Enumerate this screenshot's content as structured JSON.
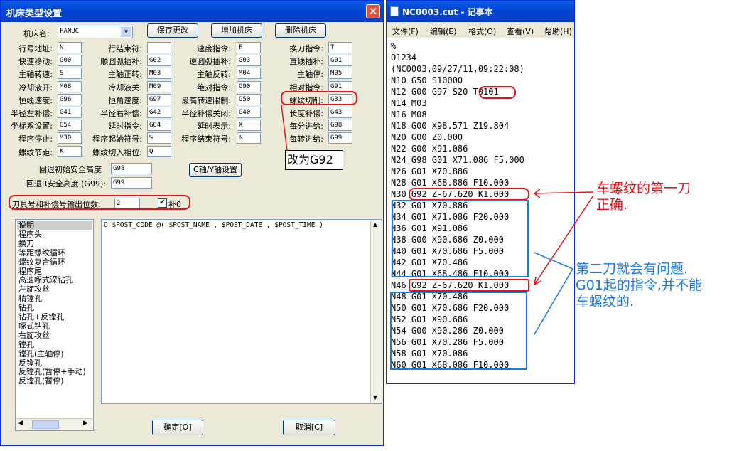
{
  "dialog": {
    "title": "机床类型设置",
    "close_glyph": "✕",
    "machine_label": "机床名:",
    "machine_value": "FANUC",
    "buttons": {
      "save": "保存更改",
      "add": "增加机床",
      "delete": "删除机床",
      "caxis": "C轴/Y轴设置",
      "ok": "确定[O]",
      "cancel": "取消[C]"
    },
    "params": [
      [
        {
          "label": "行号地址:",
          "value": "N"
        },
        {
          "label": "行结束符:",
          "value": ""
        },
        {
          "label": "速度指令:",
          "value": "F"
        },
        {
          "label": "换刀指令:",
          "value": "T"
        }
      ],
      [
        {
          "label": "快速移动:",
          "value": "G00"
        },
        {
          "label": "顺圆弧插补:",
          "value": "G02"
        },
        {
          "label": "逆圆弧插补:",
          "value": "G03"
        },
        {
          "label": "直线插补:",
          "value": "G01"
        }
      ],
      [
        {
          "label": "主轴转速:",
          "value": "S"
        },
        {
          "label": "主轴正转:",
          "value": "M03"
        },
        {
          "label": "主轴反转:",
          "value": "M04"
        },
        {
          "label": "主轴停:",
          "value": "M05"
        }
      ],
      [
        {
          "label": "冷却液开:",
          "value": "M08"
        },
        {
          "label": "冷却液关:",
          "value": "M09"
        },
        {
          "label": "绝对指令:",
          "value": "G90"
        },
        {
          "label": "相对指令:",
          "value": "G91"
        }
      ],
      [
        {
          "label": "恒线速度:",
          "value": "G96"
        },
        {
          "label": "恒角速度:",
          "value": "G97"
        },
        {
          "label": "最高转速限制:",
          "value": "G50"
        },
        {
          "label": "螺纹切削:",
          "value": "G33"
        }
      ],
      [
        {
          "label": "半径左补偿:",
          "value": "G41"
        },
        {
          "label": "半径右补偿:",
          "value": "G42"
        },
        {
          "label": "半径补偿关闭:",
          "value": "G40"
        },
        {
          "label": "长度补偿:",
          "value": "G43"
        }
      ],
      [
        {
          "label": "坐标系设置:",
          "value": "G54"
        },
        {
          "label": "延时指令:",
          "value": "G04"
        },
        {
          "label": "延时表示:",
          "value": "X"
        },
        {
          "label": "每分进给:",
          "value": "G98"
        }
      ],
      [
        {
          "label": "程序停止:",
          "value": "M30"
        },
        {
          "label": "程序起始符号:",
          "value": "%"
        },
        {
          "label": "程序结束符号:",
          "value": "%"
        },
        {
          "label": "每转进给:",
          "value": "G99"
        }
      ],
      [
        {
          "label": "螺纹节距:",
          "value": "K"
        },
        {
          "label": "螺纹切入相位:",
          "value": "Q"
        }
      ]
    ],
    "retract_init_label": "回退初始安全高度",
    "retract_init_value": "G98",
    "retract_r_label": "回退R安全高度 (G99):",
    "retract_r_value": "G99",
    "tool_digits_label": "刀具号和补偿号输出位数:",
    "tool_digits_value": "2",
    "comp_checkbox_label": "补0",
    "comp_checked": true,
    "list_items": [
      "说明",
      "程序头",
      "换刀",
      "等距螺纹循环",
      "螺纹复合循环",
      "程序尾",
      "高速啄式深钻孔",
      "左旋攻丝",
      "精镗孔",
      "钻孔",
      "钻孔+反镗孔",
      "啄式钻孔",
      "右旋攻丝",
      "镗孔",
      "镗孔(主轴停)",
      "反镗孔",
      "反镗孔(暂停+手动)",
      "反镗孔(暂停)"
    ],
    "code_text": "O $POST_CODE @( $POST_NAME , $POST_DATE , $POST_TIME )"
  },
  "notepad": {
    "title": "NC0003.cut - 记事本",
    "menu": [
      "文件(F)",
      "编辑(E)",
      "格式(O)",
      "查看(V)",
      "帮助(H)"
    ],
    "lines": [
      "%",
      "O1234",
      "(NC0003,09/27/11,09:22:08)",
      "N10 G50 S10000",
      "N12 G00 G97 S20 T0101",
      "N14 M03",
      "N16 M08",
      "N18 G00 X98.571 Z19.804",
      "N20 G00 Z0.000",
      "N22 G00 X91.086",
      "N24 G98 G01 X71.086 F5.000",
      "N26 G01 X70.886",
      "N28 G01 X68.886 F10.000",
      "N30 G92 Z-67.620 K1.000",
      "N32 G01 X70.886",
      "N34 G01 X71.086 F20.000",
      "N36 G01 X91.086",
      "N38 G00 X90.686 Z0.000",
      "N40 G01 X70.686 F5.000",
      "N42 G01 X70.486",
      "N44 G01 X68.486 F10.000",
      "N46 G92 Z-67.620 K1.000",
      "N48 G01 X70.486",
      "N50 G01 X70.686 F20.000",
      "N52 G01 X90.686",
      "N54 G00 X90.286 Z0.000",
      "N56 G01 X70.286 F5.000",
      "N58 G01 X70.086",
      "N60 G01 X68.086 F10.000"
    ]
  },
  "annotations": {
    "note_box": "改为G92",
    "red_note_1": "车螺纹的第一刀",
    "red_note_2": "正确.",
    "blue_note_1": "第二刀就会有问题.",
    "blue_note_2": "G01起的指令,并不能",
    "blue_note_3": "车螺纹的.",
    "red_color": "#e0151b",
    "blue_color": "#1a7ae6"
  }
}
